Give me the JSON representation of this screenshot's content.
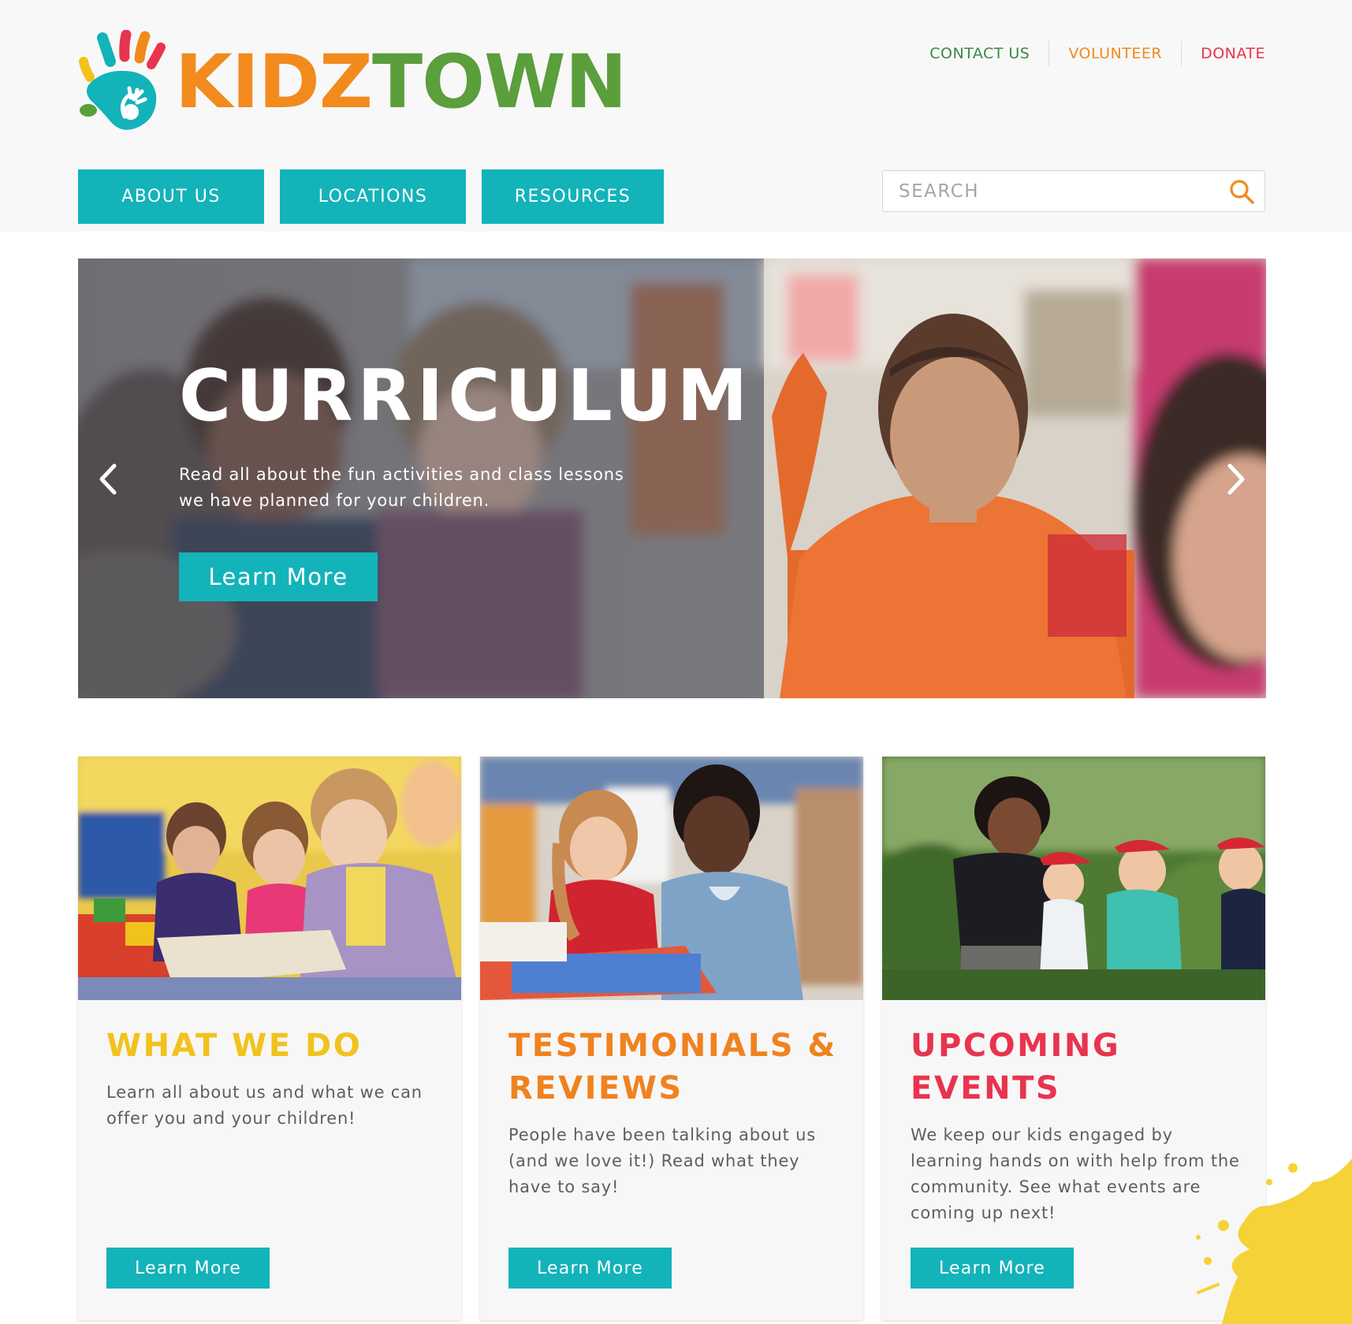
{
  "brand": {
    "logo_alt": "KidzTown",
    "logo_part1": "KIDZ",
    "logo_part2": "TOWN"
  },
  "top_links": [
    {
      "label": "CONTACT US",
      "color": "#3a8a3d"
    },
    {
      "label": "VOLUNTEER",
      "color": "#f08a1d"
    },
    {
      "label": "DONATE",
      "color": "#e8344e"
    }
  ],
  "main_nav": [
    "ABOUT US",
    "LOCATIONS",
    "RESOURCES"
  ],
  "search": {
    "placeholder": "SEARCH",
    "icon": "search-icon"
  },
  "hero": {
    "title": "CURRICULUM",
    "text": "Read all about the fun activities and class lessons we have planned for your children.",
    "button": "Learn More",
    "prev_icon": "chevron-left-icon",
    "next_icon": "chevron-right-icon"
  },
  "cards": [
    {
      "title": "WHAT WE DO",
      "title_color": "#f2c21c",
      "body": "Learn all about us and what we can offer you and your children!",
      "button": "Learn More"
    },
    {
      "title": "TESTIMONIALS & REVIEWS",
      "title_color": "#f0821f",
      "body": "People have been talking about us (and we love it!) Read what they have to say!",
      "button": "Learn More"
    },
    {
      "title": "UPCOMING EVENTS",
      "title_color": "#e8344e",
      "body": "We keep our kids engaged by learning hands on with help from the community. See what events are coming up next!",
      "button": "Learn More"
    }
  ],
  "colors": {
    "accent": "#13b3ba",
    "header_bg": "#f8f8f8",
    "card_bg": "#f7f7f7",
    "splat": "#f5d238"
  }
}
